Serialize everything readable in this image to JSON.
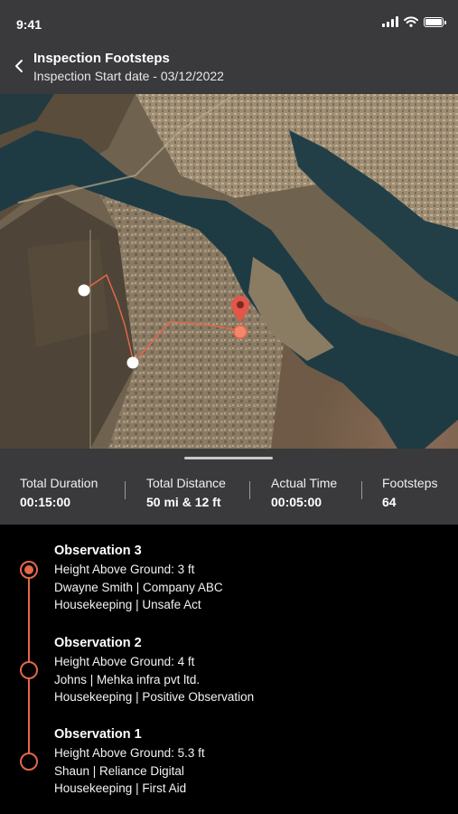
{
  "status_bar": {
    "time": "9:41"
  },
  "header": {
    "title": "Inspection Footsteps",
    "subtitle": "Inspection Start date - 03/12/2022"
  },
  "colors": {
    "accent": "#e2674b",
    "panel": "#3a3a3c",
    "background": "#000000"
  },
  "stats": [
    {
      "label": "Total Duration",
      "value": "00:15:00"
    },
    {
      "label": "Total Distance",
      "value": "50 mi & 12 ft"
    },
    {
      "label": "Actual Time",
      "value": "00:05:00"
    },
    {
      "label": "Footsteps",
      "value": "64"
    }
  ],
  "observations": [
    {
      "title": "Observation 3",
      "height": "Height Above Ground: 3 ft",
      "person": "Dwayne Smith | Company ABC",
      "category": "Housekeeping | Unsafe Act",
      "active": true
    },
    {
      "title": "Observation 2",
      "height": "Height Above Ground: 4 ft",
      "person": "Johns | Mehka infra pvt ltd.",
      "category": "Housekeeping | Positive Observation",
      "active": false
    },
    {
      "title": "Observation 1",
      "height": "Height Above Ground: 5.3 ft",
      "person": "Shaun | Reliance Digital",
      "category": "Housekeeping | First Aid",
      "active": false
    }
  ],
  "icons": {
    "back": "chevron-left-icon",
    "map_pin": "location-pin-icon"
  }
}
